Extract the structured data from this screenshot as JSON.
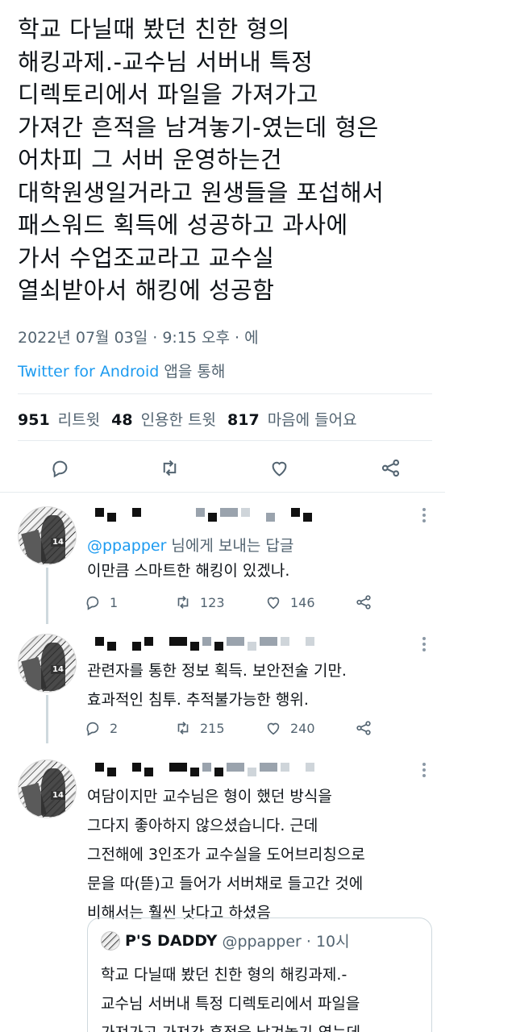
{
  "tweet": {
    "lines": [
      "학교 다닐때 봤던 친한 형의",
      "해킹과제.-교수님 서버내 특정",
      "디렉토리에서 파일을 가져가고",
      "가져간 흔적을 남겨놓기-였는데 형은",
      "어차피 그 서버 운영하는건",
      "대학원생일거라고 원생들을 포섭해서",
      "패스워드 획득에 성공하고 과사에",
      "가서 수업조교라고 교수실",
      "열쇠받아서 해킹에 성공함"
    ],
    "timestamp": "2022년 07월 03일 · 9:15 오후 · 에",
    "source": "Twitter for Android",
    "source_suffix": " 앱을 통해",
    "stats": {
      "retweets": "951",
      "retweets_label": "리트윗",
      "quotes": "48",
      "quotes_label": "인용한 트윗",
      "likes": "817",
      "likes_label": "마음에 들어요"
    },
    "actions": [
      "reply-icon",
      "retweet-icon",
      "like-icon",
      "share-icon"
    ]
  },
  "replies": [
    {
      "reply_prefix": "@ppapper",
      "reply_suffix": " 님에게 보내는 답글",
      "lines": [
        "이만큼 스마트한 해킹이 있겠나."
      ],
      "replies": "1",
      "retweets": "123",
      "likes": "146"
    },
    {
      "lines": [
        "관련자를 통한 정보 획득. 보안전술 기만.",
        "효과적인 침투. 추적불가능한 행위."
      ],
      "replies": "2",
      "retweets": "215",
      "likes": "240"
    },
    {
      "lines": [
        "여담이지만 교수님은 형이 했던 방식을",
        "그다지 좋아하지 않으셨습니다. 근데",
        "그전해에 3인조가 교수실을 도어브리칭으로",
        "문을 따(뜯)고 들어가 서버채로 들고간 것에",
        "비해서는 훨씬 낫다고 하셨음"
      ],
      "quote": {
        "name": "P'S DADDY",
        "handle": "@ppapper · 10시",
        "lines": [
          "학교 다닐때 봤던 친한 형의 해킹과제.-",
          "교수님 서버내 특정 디렉토리에서 파일을",
          "가져가고 가져간 흔적을 남겨놓기-였는데"
        ]
      }
    }
  ],
  "colors": {
    "text": "#0f1419",
    "secondary": "#536471",
    "accent": "#1d9bf0",
    "border": "#cfd9de"
  }
}
